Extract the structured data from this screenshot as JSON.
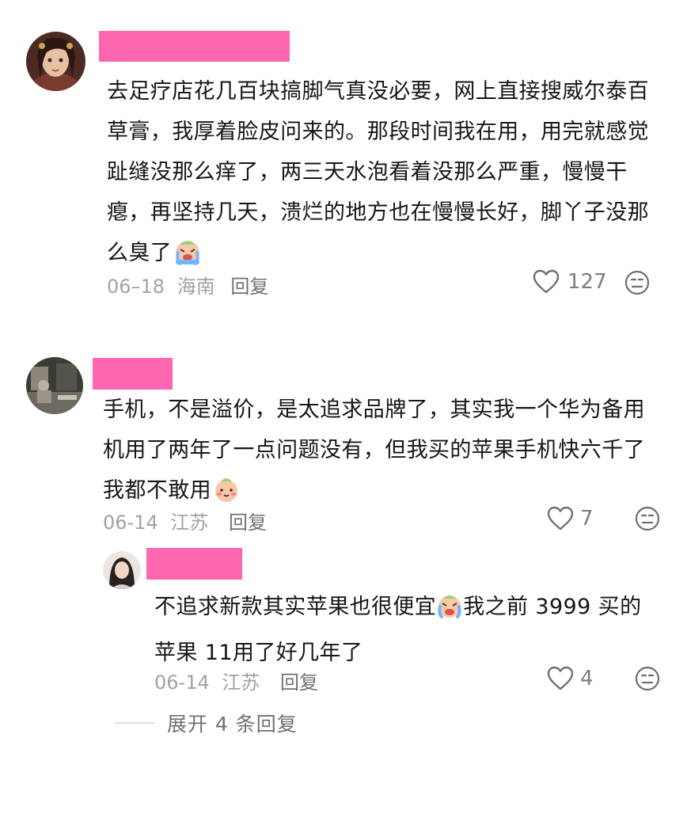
{
  "comments": [
    {
      "text": "去足疗店花几百块搞脚气真没必要，网上直接搜威尔泰百草膏，我厚着脸皮问来的。那段时间我在用，用完就感觉趾缝没那么痒了，两三天水泡看着没那么严重，慢慢干瘪，再坚持几天，溃烂的地方也在慢慢长好，脚丫子没那么臭了",
      "emoji": "crying-face-emoji",
      "date": "06–18",
      "location": "海南",
      "reply_label": "回复",
      "likes": "127"
    },
    {
      "text": "手机，不是溢价，是太追求品牌了，其实我一个华为备用机用了两年了一点问题没有，但我买的苹果手机快六千了我都不敢用",
      "emoji": "blushing-face-emoji",
      "date": "06-14",
      "location": "江苏",
      "reply_label": "回复",
      "likes": "7",
      "replies": [
        {
          "text_before": "不追求新款其实苹果也很便宜",
          "emoji": "crying-face-emoji",
          "text_after": "我之前 3999 买的苹果 11用了好几年了",
          "date": "06-14",
          "location": "江苏",
          "reply_label": "回复",
          "likes": "4"
        }
      ],
      "expand_label": "展开 4 条回复"
    }
  ],
  "colors": {
    "name_redaction": "#ff66b0",
    "meta_text": "#a2a2a2",
    "body_text": "#161616"
  }
}
